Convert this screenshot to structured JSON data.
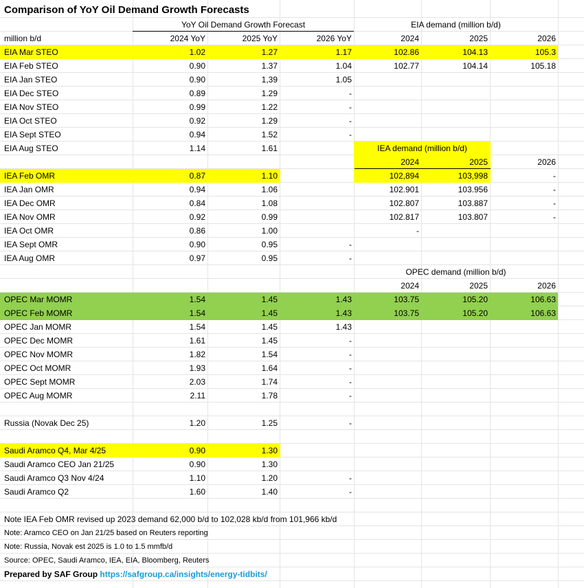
{
  "title": "Comparison of YoY Oil Demand Growth Forecasts",
  "colors": {
    "yellow": "#ffff00",
    "green": "#92d050",
    "link": "#1a9bd7"
  },
  "headers": {
    "yoy_group": "YoY Oil Demand Growth Forecast",
    "units": "million b/d",
    "yoy_2024": "2024 YoY",
    "yoy_2025": "2025 YoY",
    "yoy_2026": "2026 YoY",
    "eia_group": "EIA demand (million b/d)",
    "iea_group": "IEA demand (million b/d)",
    "opec_group": "OPEC demand (million b/d)",
    "year_2024": "2024",
    "year_2025": "2025",
    "year_2026": "2026"
  },
  "rows": [
    [
      "EIA Mar STEO",
      "1.02",
      "1.27",
      "1.17",
      "102.86",
      "104.13",
      "105.3"
    ],
    [
      "EIA Feb STEO",
      "0.90",
      "1.37",
      "1.04",
      "102.77",
      "104.14",
      "105.18"
    ],
    [
      "EIA Jan STEO",
      "0.90",
      "1,39",
      "1.05",
      "",
      "",
      ""
    ],
    [
      "EIA Dec STEO",
      "0.89",
      "1.29",
      "-",
      "",
      "",
      ""
    ],
    [
      "EIA Nov STEO",
      "0.99",
      "1.22",
      "-",
      "",
      "",
      ""
    ],
    [
      "EIA Oct STEO",
      "0.92",
      "1.29",
      "-",
      "",
      "",
      ""
    ],
    [
      "EIA Sept STEO",
      "0.94",
      "1.52",
      "-",
      "",
      "",
      ""
    ],
    [
      "EIA Aug STEO",
      "1.14",
      "1.61",
      "",
      "",
      "",
      ""
    ],
    [
      "",
      "",
      "",
      "",
      "2024",
      "2025",
      "2026"
    ],
    [
      "IEA Feb OMR",
      "0.87",
      "1.10",
      "",
      "102,894",
      "103,998",
      "-"
    ],
    [
      "IEA Jan OMR",
      "0.94",
      "1.06",
      "",
      "102.901",
      "103.956",
      "-"
    ],
    [
      "IEA Dec OMR",
      "0.84",
      "1.08",
      "",
      "102.807",
      "103.887",
      "-"
    ],
    [
      "IEA Nov OMR",
      "0.92",
      "0.99",
      "",
      "102.817",
      "103.807",
      "-"
    ],
    [
      "IEA Oct OMR",
      "0.86",
      "1.00",
      "",
      "-",
      "",
      ""
    ],
    [
      "IEA Sept OMR",
      "0.90",
      "0.95",
      "-",
      "",
      "",
      ""
    ],
    [
      "IEA Aug OMR",
      "0.97",
      "0.95",
      "-",
      "",
      "",
      ""
    ],
    [
      "",
      "",
      "",
      "",
      "",
      "",
      ""
    ],
    [
      "",
      "",
      "",
      "",
      "2024",
      "2025",
      "2026"
    ],
    [
      "OPEC Mar MOMR",
      "1.54",
      "1.45",
      "1.43",
      "103.75",
      "105.20",
      "106.63"
    ],
    [
      "OPEC Feb MOMR",
      "1.54",
      "1.45",
      "1.43",
      "103.75",
      "105.20",
      "106.63"
    ],
    [
      "OPEC Jan MOMR",
      "1.54",
      "1.45",
      "1.43",
      "",
      "",
      ""
    ],
    [
      "OPEC Dec MOMR",
      "1.61",
      "1.45",
      "-",
      "",
      "",
      ""
    ],
    [
      "OPEC Nov MOMR",
      "1.82",
      "1.54",
      "-",
      "",
      "",
      ""
    ],
    [
      "OPEC Oct MOMR",
      "1.93",
      "1.64",
      "-",
      "",
      "",
      ""
    ],
    [
      "OPEC Sept MOMR",
      "2.03",
      "1.74",
      "-",
      "",
      "",
      ""
    ],
    [
      "OPEC Aug MOMR",
      "2.11",
      "1.78",
      "-",
      "",
      "",
      ""
    ],
    [
      "",
      "",
      "",
      "",
      "",
      "",
      ""
    ],
    [
      "Russia (Novak Dec 25)",
      "1.20",
      "1.25",
      "-",
      "",
      "",
      ""
    ],
    [
      "",
      "",
      "",
      "",
      "",
      "",
      ""
    ],
    [
      "Saudi Aramco Q4, Mar 4/25",
      "0.90",
      "1.30",
      "",
      "",
      "",
      ""
    ],
    [
      "Saudi Aramco CEO Jan 21/25",
      "0.90",
      "1.30",
      "",
      "",
      "",
      ""
    ],
    [
      "Saudi Aramco Q3 Nov 4/24",
      "1.10",
      "1.20",
      "-",
      "",
      "",
      ""
    ],
    [
      "Saudi Aramco Q2",
      "1.60",
      "1.40",
      "-",
      "",
      "",
      ""
    ]
  ],
  "notes": [
    "Note IEA Feb OMR revised up 2023 demand 62,000 b/d to 102,028 kb/d from 101,966 kb/d",
    "Note: Aramco CEO on Jan 21/25 based on Reuters reporting",
    "Note: Russia, Novak est 2025 is 1.0 to 1.5 mmfb/d",
    "Source: OPEC, Saudi Aramco, IEA, EIA, Bloomberg, Reuters"
  ],
  "prepared_by": "Prepared by SAF Group",
  "link_url": "https://safgroup.ca/insights/energy-tidbits/"
}
